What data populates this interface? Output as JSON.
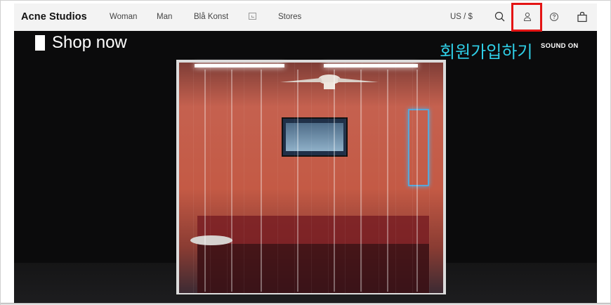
{
  "header": {
    "logo": "Acne Studios",
    "nav": {
      "woman": "Woman",
      "man": "Man",
      "bla_konst": "Blå Konst",
      "stores": "Stores"
    },
    "currency": "US / $",
    "icons": [
      "tv-icon",
      "search-icon",
      "account-icon",
      "help-icon",
      "bag-icon"
    ]
  },
  "hero": {
    "shop_now": "Shop now",
    "sound_toggle": "SOUND ON"
  },
  "annotation": {
    "label": "회원가입하기",
    "box_color": "#e41414",
    "label_color": "#2fd0e8"
  }
}
